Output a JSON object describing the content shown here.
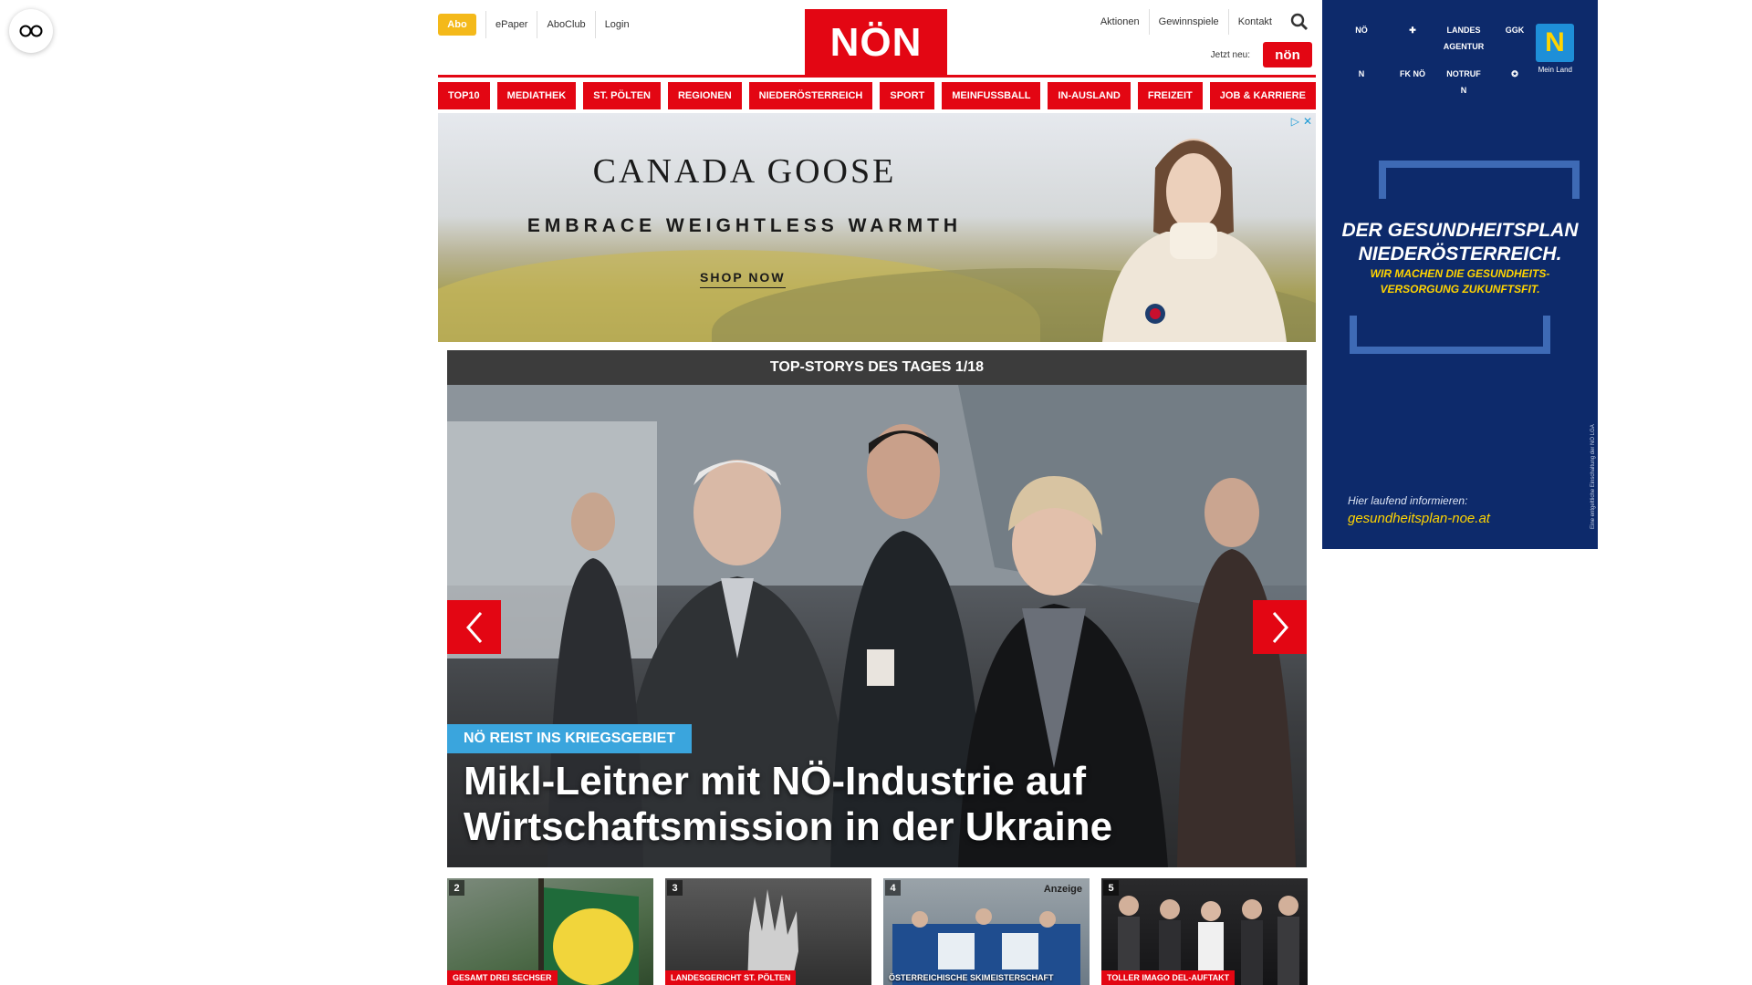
{
  "header": {
    "abo": "Abo",
    "links": [
      "ePaper",
      "AboClub",
      "Login"
    ],
    "logo": "NÖN",
    "right_links": [
      "Aktionen",
      "Gewinnspiele",
      "Kontakt"
    ],
    "jetzt_neu": "Jetzt neu:",
    "mini_logo": "nön"
  },
  "nav": [
    "TOP10",
    "MEDIATHEK",
    "ST. PÖLTEN",
    "REGIONEN",
    "NIEDERÖSTERREICH",
    "SPORT",
    "MEINFUSSBALL",
    "IN-AUSLAND",
    "FREIZEIT",
    "JOB & KARRIERE"
  ],
  "ad": {
    "brand": "CANADA GOOSE",
    "tagline": "EMBRACE WEIGHTLESS WARMTH",
    "cta": "SHOP NOW"
  },
  "skyscraper": {
    "logos": [
      "NÖ",
      "✚",
      "LANDES AGENTUR",
      "GGK",
      "N",
      "FK NÖ",
      "NOTRUF N",
      "✪"
    ],
    "badge": "N",
    "badge_label": "Mein Land",
    "title_line1": "DER GESUNDHEITSPLAN",
    "title_line2": "NIEDERÖSTERREICH.",
    "sub_line1": "WIR MACHEN DIE GESUNDHEITS-",
    "sub_line2": "VERSORGUNG ZUKUNFTSFIT.",
    "info": "Hier laufend informieren:",
    "url": "gesundheitsplan-noe.at",
    "vertical": "Eine entgeltliche Einschaltung der NÖ LGA"
  },
  "stories": {
    "heading": "TOP-STORYS DES TAGES 1/18",
    "kicker": "NÖ REIST INS KRIEGSGEBIET",
    "headline": "Mikl-Leitner mit NÖ-Industrie auf Wirtschaftsmission in der Ukraine"
  },
  "thumbs": [
    {
      "num": "2",
      "tag": "GESAMT DREI SECHSER",
      "anzeige": ""
    },
    {
      "num": "3",
      "tag": "LANDESGERICHT ST. PÖLTEN",
      "anzeige": ""
    },
    {
      "num": "4",
      "tag": "ÖSTERREICHISCHE SKIMEISTERSCHAFT",
      "anzeige": "Anzeige"
    },
    {
      "num": "5",
      "tag": "TOLLER IMAGO DEL-AUFTAKT",
      "anzeige": ""
    }
  ],
  "colors": {
    "brand_red": "#e30613",
    "abo_yellow": "#f4b91a",
    "kicker_blue": "#3aa5dd",
    "sky_navy": "#0d2a6b"
  }
}
